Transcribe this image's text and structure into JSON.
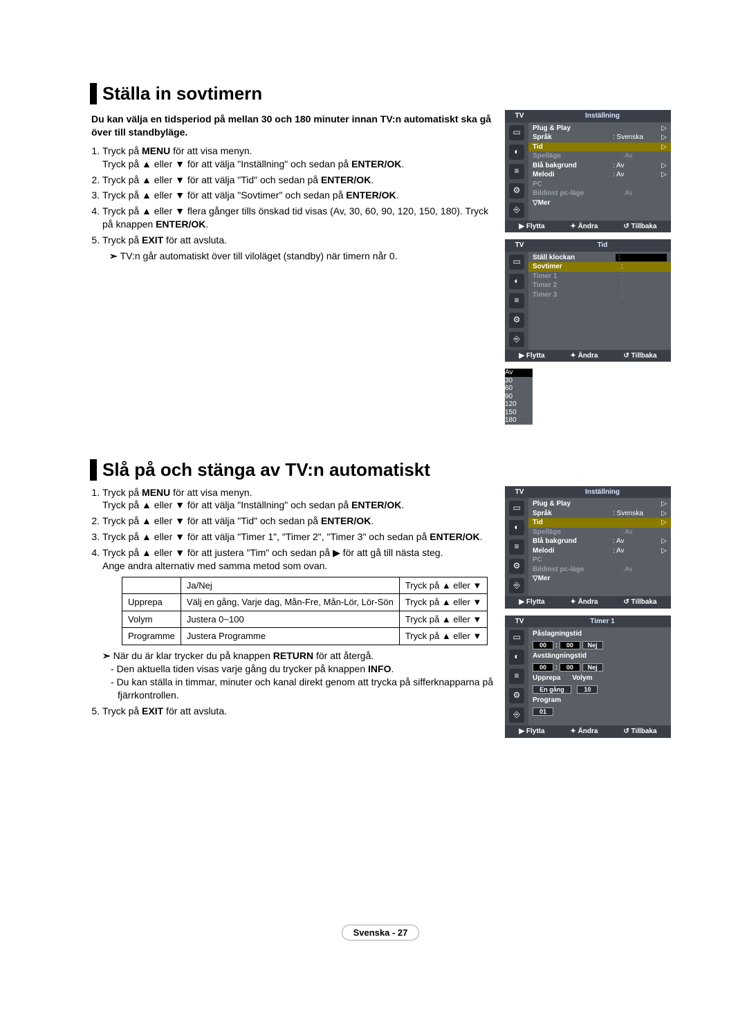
{
  "section1": {
    "heading": "Ställa in sovtimern",
    "lead": "Du kan välja en tidsperiod på mellan 30 och 180 minuter innan TV:n automatiskt ska gå över till standbyläge.",
    "steps": {
      "s1a": "Tryck på ",
      "s1b": "MENU",
      "s1c": " för att visa menyn.",
      "s1d": "Tryck på ▲ eller ▼ för att välja \"Inställning\" och sedan på ",
      "s1e": "ENTER/OK",
      "s1f": ".",
      "s2a": "Tryck på ▲ eller ▼ för att välja \"Tid\" och sedan på ",
      "s2b": "ENTER/OK",
      "s2c": ".",
      "s3a": "Tryck på ▲ eller ▼ för att välja \"Sovtimer\" och sedan på ",
      "s3b": "ENTER/OK",
      "s3c": ".",
      "s4a": "Tryck på ▲ eller ▼ flera gånger tills önskad tid visas (Av, 30, 60, 90, 120, 150, 180). Tryck på knappen ",
      "s4b": "ENTER/OK",
      "s4c": ".",
      "s5a": "Tryck på ",
      "s5b": "EXIT",
      "s5c": " för att avsluta."
    },
    "note": "TV:n går automatiskt över till viloläget (standby) när timern når 0."
  },
  "section2": {
    "heading": "Slå på och stänga av TV:n automatiskt",
    "steps": {
      "s1a": "Tryck på ",
      "s1b": "MENU",
      "s1c": " för att visa menyn.",
      "s1d": "Tryck på ▲ eller ▼ för att välja \"Inställning\" och sedan på ",
      "s1e": "ENTER/OK",
      "s1f": ".",
      "s2a": "Tryck på ▲ eller ▼ för att välja \"Tid\" och sedan på ",
      "s2b": "ENTER/OK",
      "s2c": ".",
      "s3a": "Tryck på ▲ eller ▼ för att välja \"Timer 1\", \"Timer 2\", \"Timer 3\" och sedan på ",
      "s3b": "ENTER/OK",
      "s3c": ".",
      "s4a": "Tryck på ▲ eller ▼ för att justera \"Tim\" och sedan på ▶ för att gå till nästa steg.",
      "s4b": "Ange andra alternativ med samma metod som ovan.",
      "s5a": "Tryck på ",
      "s5b": "EXIT",
      "s5c": " för att avsluta."
    },
    "table": {
      "h1": "",
      "h2": "Ja/Nej",
      "h3": "Tryck på ▲ eller ▼",
      "r1c1": "Upprepa",
      "r1c2": "Välj en gång, Varje dag, Mån-Fre, Mån-Lör, Lör-Sön",
      "r1c3": "Tryck på ▲ eller ▼",
      "r2c1": "Volym",
      "r2c2": "Justera 0~100",
      "r2c3": "Tryck på ▲ eller ▼",
      "r3c1": "Programme",
      "r3c2": "Justera Programme",
      "r3c3": "Tryck på ▲ eller ▼"
    },
    "notes": {
      "n1a": "När du är klar trycker du på knappen ",
      "n1b": "RETURN",
      "n1c": " för att återgå.",
      "d1a": "Den aktuella tiden visas varje gång du trycker på knappen ",
      "d1b": "INFO",
      "d1c": ".",
      "d2": "Du kan ställa in timmar, minuter och kanal direkt genom att trycka på sifferknapparna på fjärrkontrollen."
    }
  },
  "osd1": {
    "tv": "TV",
    "title": "Inställning",
    "rows": {
      "plug": "Plug & Play",
      "sprak": "Språk",
      "sprak_v": ": Svenska",
      "tid": "Tid",
      "spellage": "Spelläge",
      "spellage_v": ": Av",
      "bla": "Blå bakgrund",
      "bla_v": ": Av",
      "melodi": "Melodi",
      "melodi_v": ": Av",
      "pc": "PC",
      "bild": "Bildinst pc-läge",
      "bild_v": ": Av",
      "mer": "▽Mer"
    },
    "foot": {
      "f1": "▶ Flytta",
      "f2": "✦ Ändra",
      "f3": "↺ Tillbaka"
    }
  },
  "osd2": {
    "tv": "TV",
    "title": "Tid",
    "rows": {
      "klockan": "Ställ klockan",
      "klockan_v": ":",
      "sovtimer": "Sovtimer",
      "sovtimer_v": ":",
      "t1": "Timer 1",
      "t1_v": ":",
      "t2": "Timer 2",
      "t2_v": ":",
      "t3": "Timer 3",
      "t3_v": ":"
    },
    "popup": {
      "p0": "Av",
      "p1": "30",
      "p2": "60",
      "p3": "90",
      "p4": "120",
      "p5": "150",
      "p6": "180"
    },
    "foot": {
      "f1": "▶ Flytta",
      "f2": "✦ Ändra",
      "f3": "↺ Tillbaka"
    }
  },
  "osd3": {
    "tv": "TV",
    "title": "Inställning",
    "foot": {
      "f1": "▶ Flytta",
      "f2": "✦ Ändra",
      "f3": "↺ Tillbaka"
    }
  },
  "osd4": {
    "tv": "TV",
    "title": "Timer 1",
    "rows": {
      "pas": "Påslagningstid",
      "h1": "00",
      "m1": "00",
      "off1": "Nej",
      "avs": "Avstängningstid",
      "h2": "00",
      "m2": "00",
      "off2": "Nej",
      "upp": "Upprepa",
      "vol": "Volym",
      "eng": "En gång",
      "v10": "10",
      "prog": "Program",
      "p01": "01"
    },
    "foot": {
      "f1": "▶ Flytta",
      "f2": "✦ Ändra",
      "f3": "↺ Tillbaka"
    }
  },
  "footer": "Svenska - 27"
}
